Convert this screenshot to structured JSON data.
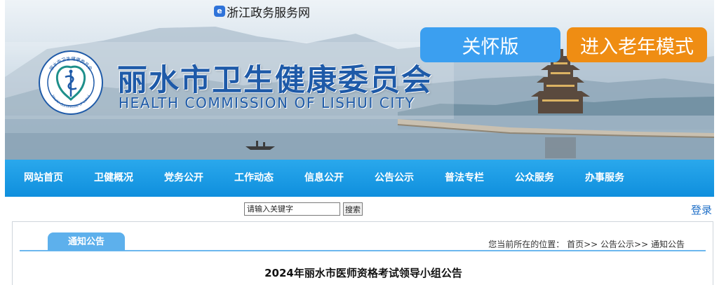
{
  "header": {
    "zj_link_label": "浙江政务服务网",
    "zj_icon_glyph": "e",
    "title": "丽水市卫生健康委员会",
    "subtitle": "HEALTH COMMISSION OF LISHUI CITY",
    "emblem_text": "丽水市卫生健康委员会",
    "emblem_text_en": "Health Committee of Lishui",
    "care_button": "关怀版",
    "elder_button": "进入老年模式",
    "colors": {
      "title": "#1e5aa8",
      "care": "#3b9ff0",
      "elder": "#ef8d13"
    }
  },
  "nav": {
    "items": [
      {
        "label": "网站首页"
      },
      {
        "label": "卫健概况"
      },
      {
        "label": "党务公开"
      },
      {
        "label": "工作动态"
      },
      {
        "label": "信息公开"
      },
      {
        "label": "公告公示"
      },
      {
        "label": "普法专栏"
      },
      {
        "label": "公众服务"
      },
      {
        "label": "办事服务"
      }
    ],
    "color": "#1a9be4"
  },
  "search": {
    "placeholder": "请输入关键字",
    "button_label": "搜索"
  },
  "login_label": "登录",
  "content": {
    "tab_label": "通知公告",
    "breadcrumb": {
      "prefix": "您当前所在的位置：",
      "home": "首页",
      "sep1": ">>",
      "section": "公告公示",
      "sep2": ">>",
      "current": "通知公告"
    },
    "article_title": "2024年丽水市医师资格考试领导小组公告"
  }
}
